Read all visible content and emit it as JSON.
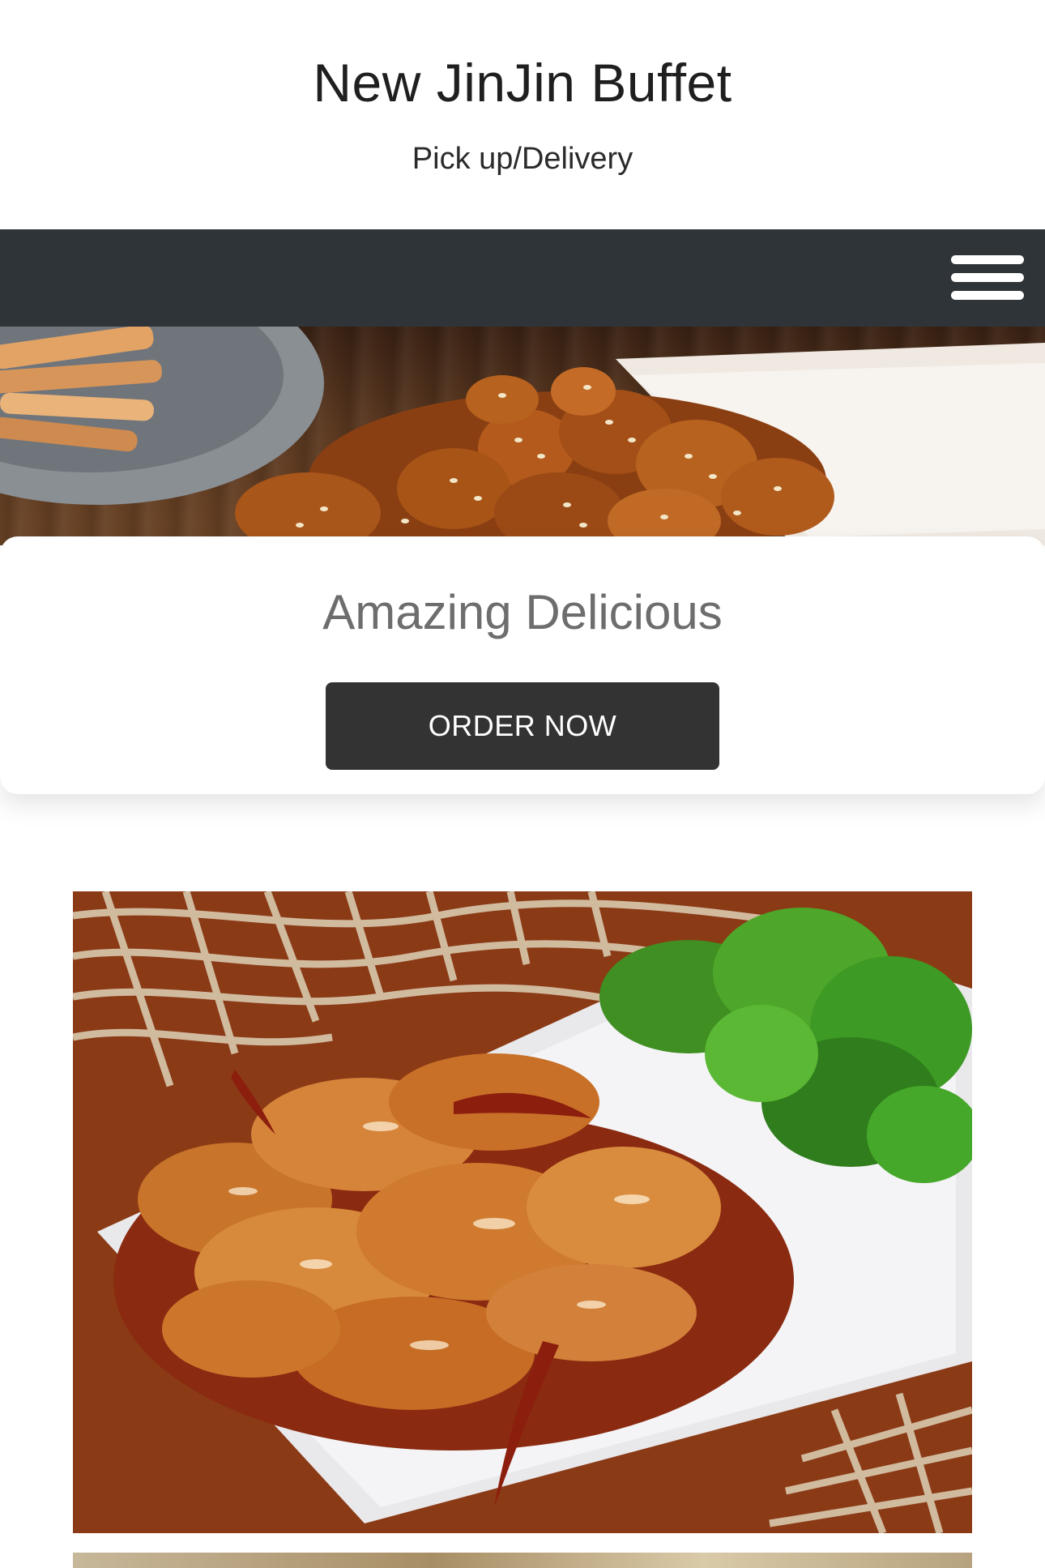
{
  "header": {
    "title": "New JinJin Buffet",
    "subtitle": "Pick up/Delivery"
  },
  "navbar": {
    "menu_icon": "hamburger-menu-icon",
    "background_color": "#2f3439"
  },
  "hero": {
    "image": "sesame-chicken-photo"
  },
  "promo": {
    "heading": "Amazing Delicious",
    "button_label": "ORDER NOW",
    "button_color": "#333333"
  },
  "gallery": {
    "images": [
      "orange-chicken-broccoli-photo",
      "food-photo-partial"
    ]
  }
}
